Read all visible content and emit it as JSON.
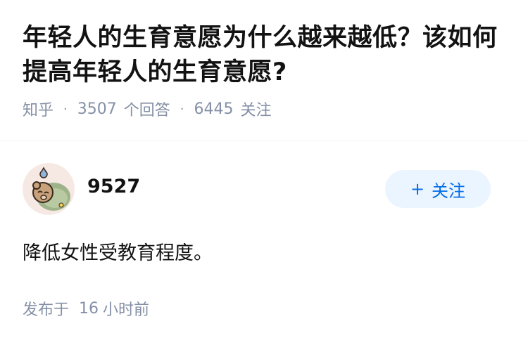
{
  "question": {
    "title": "年轻人的生育意愿为什么越来越低？该如何提高年轻人的生育意愿?",
    "source": "知乎",
    "separator": "·",
    "answer_count": "3507",
    "answer_label": "个回答",
    "follower_count": "6445",
    "follower_label": "关注"
  },
  "answer": {
    "author": {
      "name": "9527",
      "avatar_icon": "sleeping-bear-avatar"
    },
    "follow_button": {
      "icon": "plus-icon",
      "plus_glyph": "+",
      "label": "关注"
    },
    "content": "降低女性受教育程度。",
    "publish": {
      "prefix": "发布于",
      "time_value": "16",
      "time_unit": "小时前"
    }
  },
  "colors": {
    "accent": "#056de8",
    "button_bg": "#ebf5ff",
    "meta_text": "#8590a6",
    "title_text": "#121212"
  }
}
